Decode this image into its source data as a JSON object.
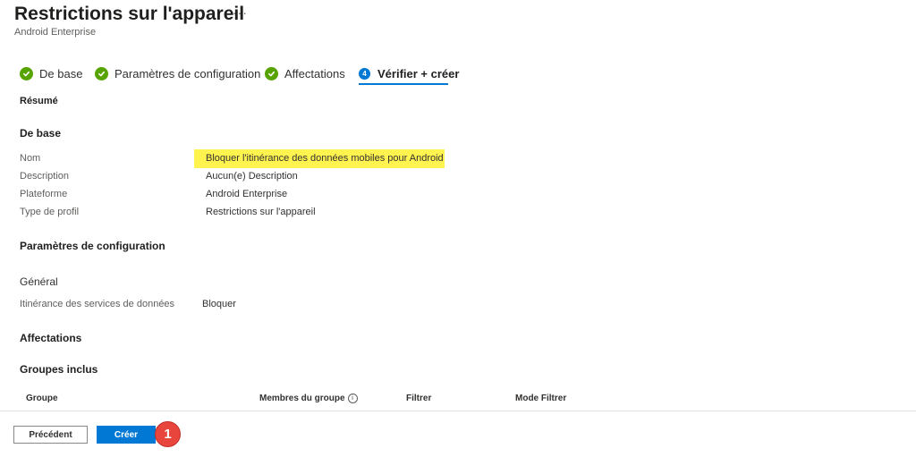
{
  "header": {
    "title": "Restrictions sur l'appareil",
    "subtitle": "Android Enterprise",
    "more": "···"
  },
  "steps": [
    {
      "label": "De base",
      "state": "done",
      "icon": "check-circle-icon"
    },
    {
      "label": "Paramètres de configuration",
      "state": "done",
      "icon": "check-circle-icon"
    },
    {
      "label": "Affectations",
      "state": "done",
      "icon": "check-circle-icon"
    },
    {
      "label": "Vérifier + créer",
      "state": "active",
      "number": "4"
    }
  ],
  "summary_label": "Résumé",
  "basics": {
    "heading": "De base",
    "rows": [
      {
        "label": "Nom",
        "value": "Bloquer l'itinérance des données mobiles pour Android",
        "highlighted": true
      },
      {
        "label": "Description",
        "value": "Aucun(e) Description"
      },
      {
        "label": "Plateforme",
        "value": "Android Enterprise"
      },
      {
        "label": "Type de profil",
        "value": "Restrictions sur l'appareil"
      }
    ]
  },
  "config": {
    "heading": "Paramètres de configuration",
    "group": "Général",
    "rows": [
      {
        "label": "Itinérance des services de données",
        "value": "Bloquer"
      }
    ]
  },
  "assignments": {
    "heading": "Affectations",
    "included_heading": "Groupes inclus",
    "columns": [
      "Groupe",
      "Membres du groupe",
      "Filtrer",
      "Mode Filtrer"
    ]
  },
  "footer": {
    "previous": "Précédent",
    "create": "Créer",
    "badge": "1"
  },
  "colors": {
    "accent": "#0078d4",
    "success": "#57a300",
    "highlight": "#fff44f",
    "badge": "#e8453c"
  }
}
